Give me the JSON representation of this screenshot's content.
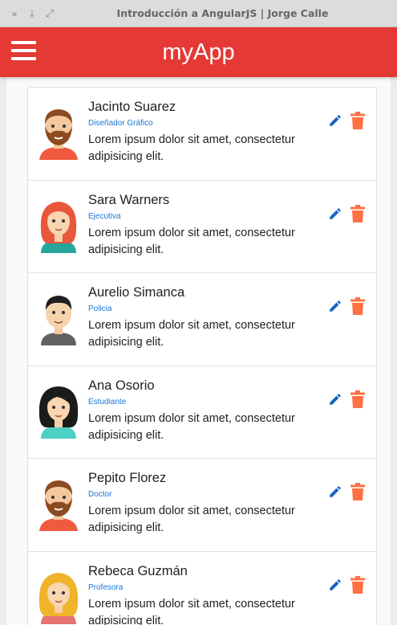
{
  "window": {
    "title": "Introducción a AngularJS | Jorge Calle",
    "close_glyph": "×",
    "minimize_glyph": "⤓",
    "maximize_glyph": "⤢"
  },
  "appbar": {
    "title": "myApp",
    "menu_icon": "hamburger-menu-icon",
    "color": "#e53935"
  },
  "colors": {
    "edit_icon": "#1565c0",
    "delete_icon": "#ff7043",
    "role_text": "#1976d2"
  },
  "contacts": [
    {
      "name": "Jacinto Suarez",
      "role": "Diseñador Gráfico",
      "description": "Lorem ipsum dolor sit amet, consectetur adipisicing elit.",
      "avatar": "bearded-man-avatar",
      "edit_icon": "pencil-icon",
      "delete_icon": "trash-icon"
    },
    {
      "name": "Sara Warners",
      "role": "Ejecutiva",
      "description": "Lorem ipsum dolor sit amet, consectetur adipisicing elit.",
      "avatar": "red-haired-woman-avatar",
      "edit_icon": "pencil-icon",
      "delete_icon": "trash-icon"
    },
    {
      "name": "Aurelio Simanca",
      "role": "Policia",
      "description": "Lorem ipsum dolor sit amet, consectetur adipisicing elit.",
      "avatar": "dark-haired-man-avatar",
      "edit_icon": "pencil-icon",
      "delete_icon": "trash-icon"
    },
    {
      "name": "Ana Osorio",
      "role": "Estudiante",
      "description": "Lorem ipsum dolor sit amet, consectetur adipisicing elit.",
      "avatar": "black-haired-woman-avatar",
      "edit_icon": "pencil-icon",
      "delete_icon": "trash-icon"
    },
    {
      "name": "Pepito Florez",
      "role": "Doctor",
      "description": "Lorem ipsum dolor sit amet, consectetur adipisicing elit.",
      "avatar": "bearded-man-avatar",
      "edit_icon": "pencil-icon",
      "delete_icon": "trash-icon"
    },
    {
      "name": "Rebeca Guzmán",
      "role": "Profesora",
      "description": "Lorem ipsum dolor sit amet, consectetur adipisicing elit.",
      "avatar": "blonde-woman-avatar",
      "edit_icon": "pencil-icon",
      "delete_icon": "trash-icon"
    }
  ]
}
